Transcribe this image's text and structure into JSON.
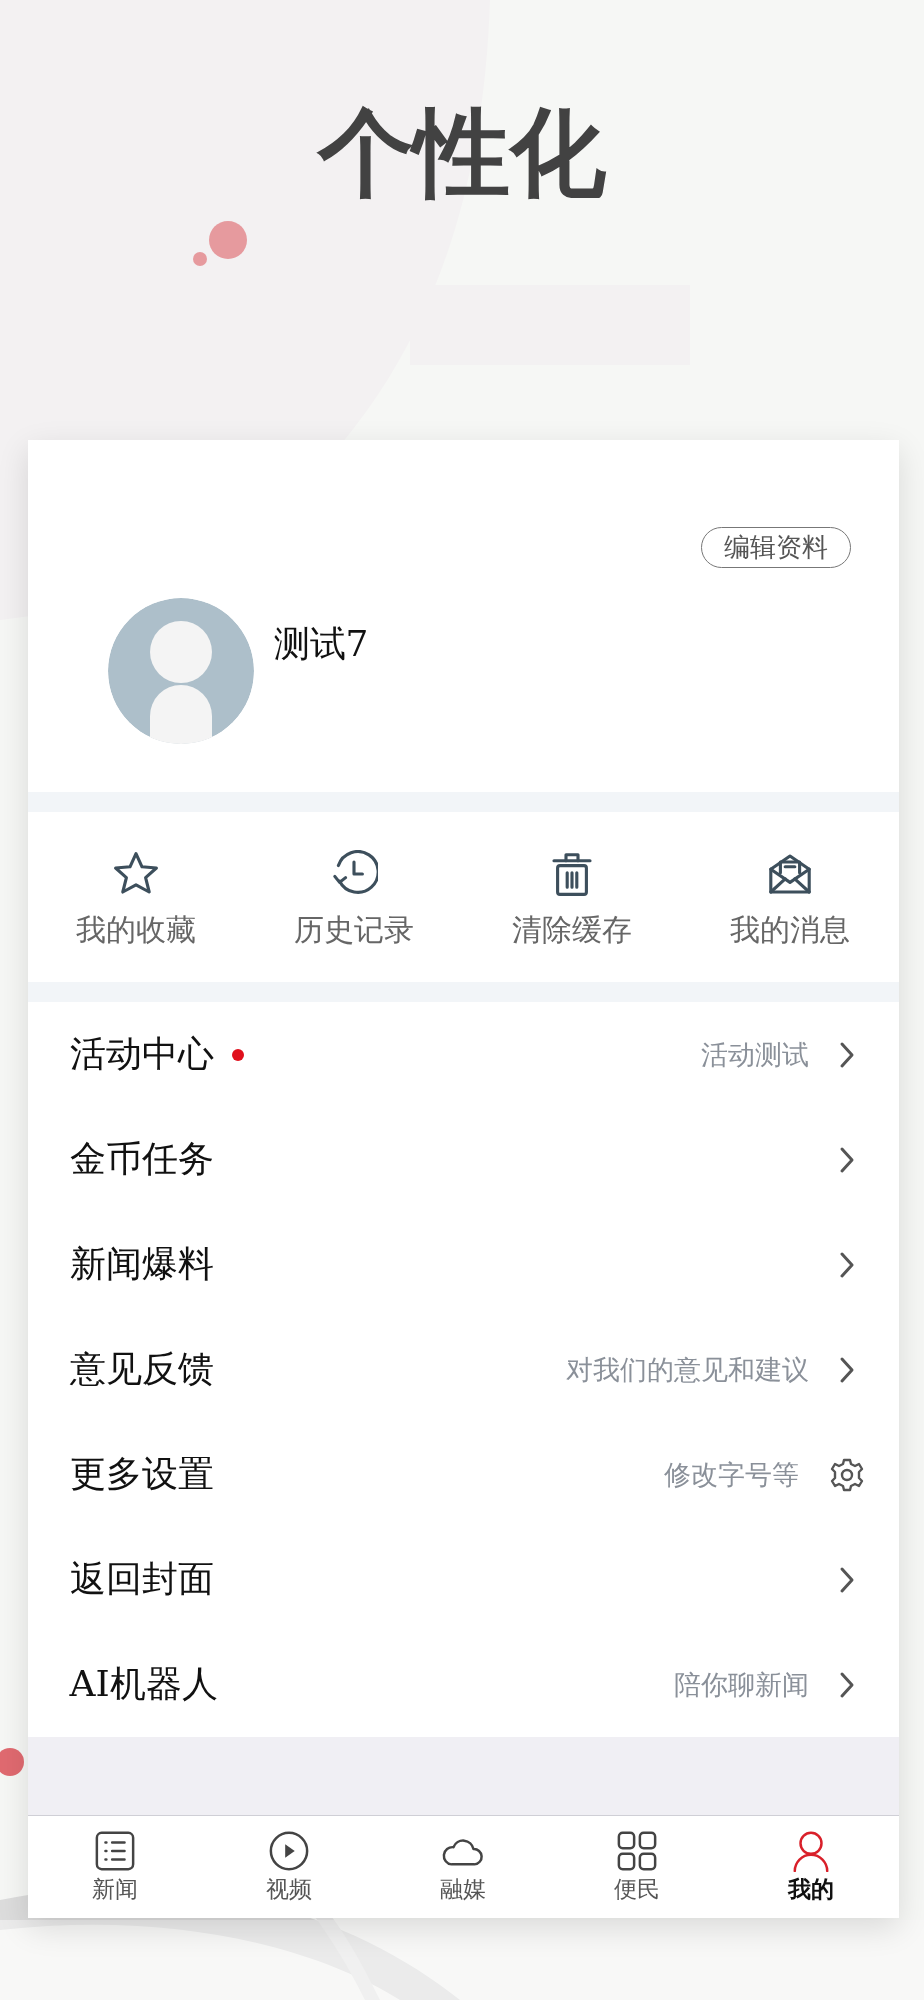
{
  "headline": "个性化",
  "profile": {
    "edit_button": "编辑资料",
    "name": "测试7"
  },
  "shortcuts": [
    {
      "label": "我的收藏"
    },
    {
      "label": "历史记录"
    },
    {
      "label": "清除缓存"
    },
    {
      "label": "我的消息"
    }
  ],
  "menu": [
    {
      "label": "活动中心",
      "hint": "活动测试",
      "new": true,
      "kind": "link"
    },
    {
      "label": "金币任务",
      "new": false,
      "kind": "link"
    },
    {
      "label": "新闻爆料",
      "new": false,
      "kind": "link"
    },
    {
      "label": "意见反馈",
      "hint": "对我们的意见和建议",
      "new": false,
      "kind": "link"
    },
    {
      "label": "更多设置",
      "hint": "修改字号等",
      "new": false,
      "kind": "settings"
    },
    {
      "label": "返回封面",
      "new": false,
      "kind": "link"
    },
    {
      "label": "AI机器人",
      "hint": "陪你聊新闻",
      "new": false,
      "kind": "link"
    }
  ],
  "tab_bar": [
    {
      "label": "新闻",
      "selected": false
    },
    {
      "label": "视频",
      "selected": false
    },
    {
      "label": "融媒",
      "selected": false
    },
    {
      "label": "便民",
      "selected": false
    },
    {
      "label": "我的",
      "selected": true
    }
  ]
}
